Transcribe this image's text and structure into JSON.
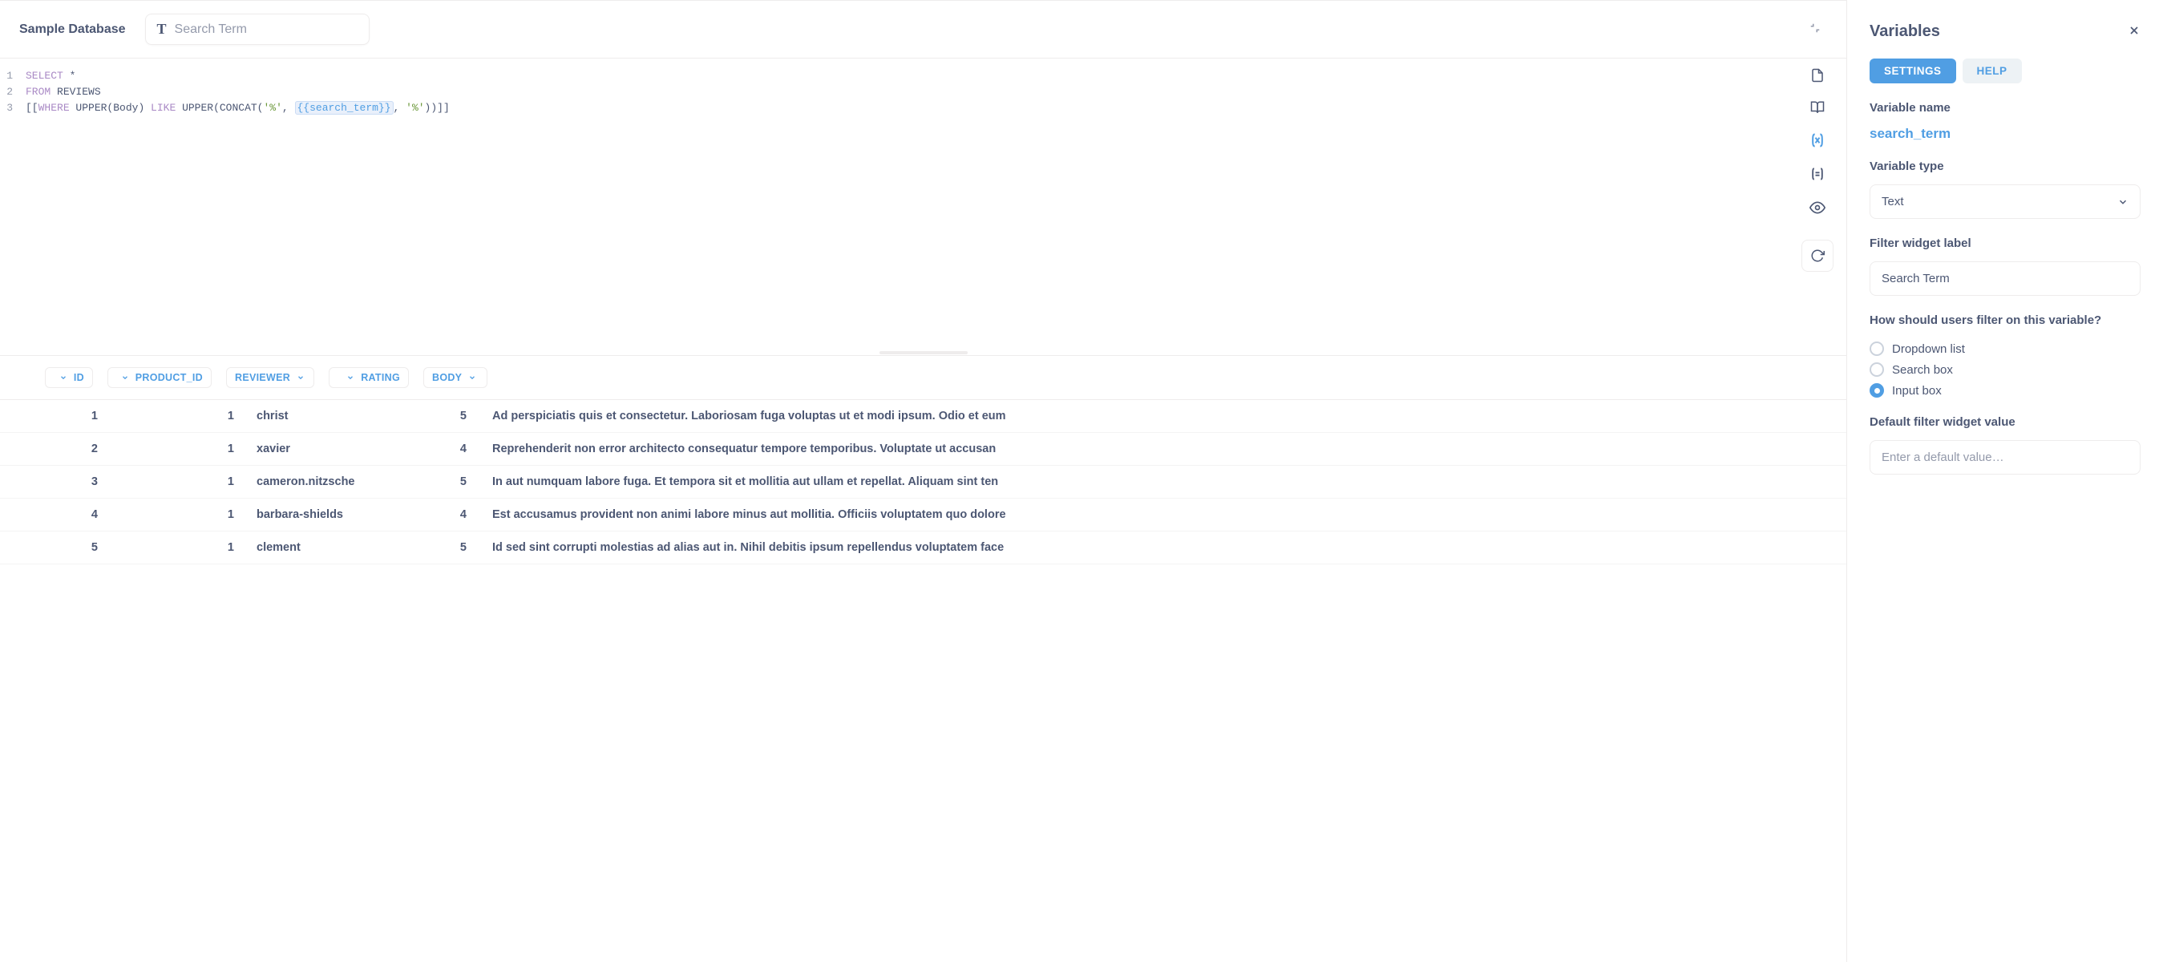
{
  "header": {
    "database_name": "Sample Database",
    "search_placeholder": "Search Term"
  },
  "editor": {
    "gutter": [
      "1",
      "2",
      "3"
    ],
    "line1_kw": "SELECT",
    "line1_rest": " *",
    "line2_kw": "FROM",
    "line2_rest": " REVIEWS",
    "line3_p1": "[[",
    "line3_kw1": "WHERE",
    "line3_p2": " UPPER(Body) ",
    "line3_kw2": "LIKE",
    "line3_p3": " UPPER(CONCAT(",
    "line3_str1": "'%'",
    "line3_p4": ", ",
    "line3_var": "{{search_term}}",
    "line3_p5": ", ",
    "line3_str2": "'%'",
    "line3_p6": "))]]"
  },
  "columns": [
    "ID",
    "PRODUCT_ID",
    "REVIEWER",
    "RATING",
    "BODY"
  ],
  "rows": [
    {
      "id": "1",
      "product_id": "1",
      "reviewer": "christ",
      "rating": "5",
      "body": "Ad perspiciatis quis et consectetur. Laboriosam fuga voluptas ut et modi ipsum. Odio et eum"
    },
    {
      "id": "2",
      "product_id": "1",
      "reviewer": "xavier",
      "rating": "4",
      "body": "Reprehenderit non error architecto consequatur tempore temporibus. Voluptate ut accusan"
    },
    {
      "id": "3",
      "product_id": "1",
      "reviewer": "cameron.nitzsche",
      "rating": "5",
      "body": "In aut numquam labore fuga. Et tempora sit et mollitia aut ullam et repellat. Aliquam sint ten"
    },
    {
      "id": "4",
      "product_id": "1",
      "reviewer": "barbara-shields",
      "rating": "4",
      "body": "Est accusamus provident non animi labore minus aut mollitia. Officiis voluptatem quo dolore"
    },
    {
      "id": "5",
      "product_id": "1",
      "reviewer": "clement",
      "rating": "5",
      "body": "Id sed sint corrupti molestias ad alias aut in. Nihil debitis ipsum repellendus voluptatem face"
    }
  ],
  "sidebar": {
    "title": "Variables",
    "tabs": {
      "settings": "SETTINGS",
      "help": "HELP"
    },
    "variable_name_label": "Variable name",
    "variable_name": "search_term",
    "variable_type_label": "Variable type",
    "variable_type_value": "Text",
    "filter_label_label": "Filter widget label",
    "filter_label_value": "Search Term",
    "filter_mode_label": "How should users filter on this variable?",
    "filter_modes": {
      "dropdown": "Dropdown list",
      "search": "Search box",
      "input": "Input box"
    },
    "filter_mode_selected": "input",
    "default_value_label": "Default filter widget value",
    "default_value_placeholder": "Enter a default value…"
  }
}
